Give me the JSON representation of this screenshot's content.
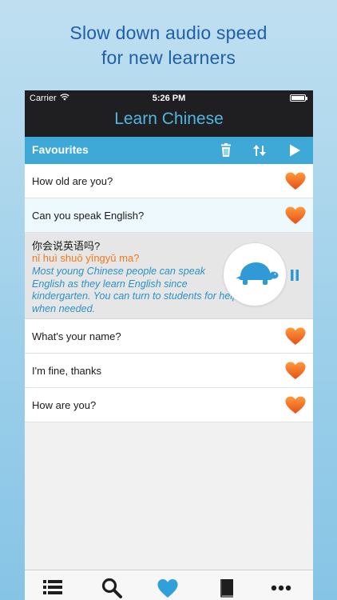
{
  "headline": {
    "line1": "Slow down audio speed",
    "line2": "for new learners"
  },
  "status_bar": {
    "carrier": "Carrier",
    "time": "5:26 PM"
  },
  "nav": {
    "title": "Learn Chinese"
  },
  "toolbar": {
    "title": "Favourites",
    "icons": [
      "trash-icon",
      "sort-icon",
      "play-icon"
    ]
  },
  "rows_top": [
    {
      "text": "How old are you?"
    },
    {
      "text": "Can you speak English?"
    }
  ],
  "expanded": {
    "chinese": "你会说英语吗?",
    "pinyin": "nǐ huì shuō yīngyǔ ma?",
    "translation": "Most young Chinese people can speak English as they learn English since kindergarten. You can turn to students for help when needed."
  },
  "rows_bottom": [
    {
      "text": "What's your name?"
    },
    {
      "text": "I'm fine, thanks"
    },
    {
      "text": "How are you?"
    }
  ],
  "tabbar": {
    "icons": [
      "list-icon",
      "search-icon",
      "heart-icon",
      "book-icon",
      "more-icon"
    ],
    "active": "heart-icon"
  },
  "colors": {
    "headline": "#1f5fa8",
    "nav_title": "#4fb7e0",
    "toolbar": "#3ea8d6",
    "pinyin": "#f07a1e",
    "translation": "#2a92c8",
    "heart": "#f26b22",
    "turtle": "#2f9ad6"
  }
}
